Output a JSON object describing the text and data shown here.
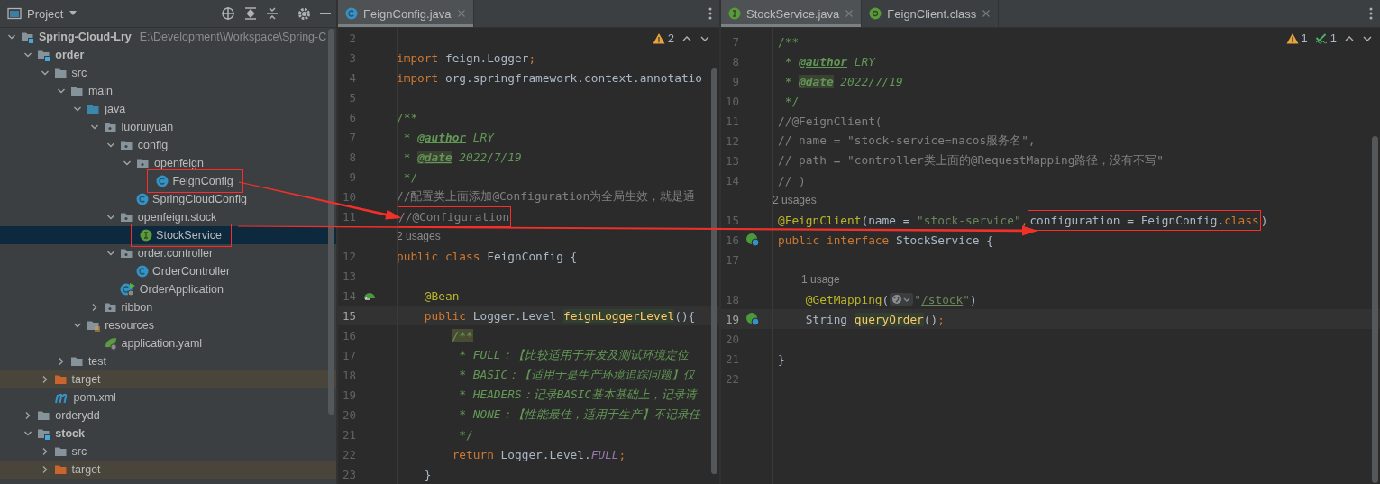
{
  "project_panel": {
    "title": "Project",
    "tree": [
      {
        "label": "Spring-Cloud-Lry",
        "kind": "module",
        "path": "E:\\Development\\Workspace\\Spring-C",
        "expanded": true,
        "selected": false,
        "boxed": false,
        "children": [
          {
            "label": "order",
            "kind": "module",
            "expanded": true,
            "selected": false,
            "boxed": false,
            "children": [
              {
                "label": "src",
                "kind": "folder",
                "expanded": true,
                "selected": false,
                "boxed": false,
                "children": [
                  {
                    "label": "main",
                    "kind": "folder",
                    "expanded": true,
                    "selected": false,
                    "boxed": false,
                    "children": [
                      {
                        "label": "java",
                        "kind": "source",
                        "expanded": true,
                        "selected": false,
                        "boxed": false,
                        "children": [
                          {
                            "label": "luoruiyuan",
                            "kind": "package",
                            "expanded": true,
                            "selected": false,
                            "boxed": false,
                            "children": [
                              {
                                "label": "config",
                                "kind": "package",
                                "expanded": true,
                                "selected": false,
                                "boxed": false,
                                "children": [
                                  {
                                    "label": "openfeign",
                                    "kind": "package",
                                    "expanded": true,
                                    "selected": false,
                                    "boxed": false,
                                    "children": [
                                      {
                                        "label": "FeignConfig",
                                        "kind": "class",
                                        "selected": false,
                                        "boxed": true
                                      }
                                    ]
                                  },
                                  {
                                    "label": "SpringCloudConfig",
                                    "kind": "class",
                                    "selected": false,
                                    "boxed": false
                                  }
                                ]
                              },
                              {
                                "label": "openfeign.stock",
                                "kind": "package",
                                "expanded": true,
                                "selected": false,
                                "boxed": false,
                                "children": [
                                  {
                                    "label": "StockService",
                                    "kind": "interface",
                                    "selected": true,
                                    "boxed": true
                                  }
                                ]
                              },
                              {
                                "label": "order.controller",
                                "kind": "package",
                                "expanded": true,
                                "selected": false,
                                "boxed": false,
                                "children": [
                                  {
                                    "label": "OrderController",
                                    "kind": "class",
                                    "selected": false,
                                    "boxed": false
                                  }
                                ]
                              },
                              {
                                "label": "OrderApplication",
                                "kind": "app",
                                "selected": false,
                                "boxed": false
                              }
                            ]
                          },
                          {
                            "label": "ribbon",
                            "kind": "package",
                            "expanded": false,
                            "selected": false,
                            "boxed": false
                          }
                        ]
                      },
                      {
                        "label": "resources",
                        "kind": "resources",
                        "expanded": true,
                        "selected": false,
                        "boxed": false,
                        "children": [
                          {
                            "label": "application.yaml",
                            "kind": "yaml",
                            "selected": false,
                            "boxed": false
                          }
                        ]
                      }
                    ]
                  },
                  {
                    "label": "test",
                    "kind": "folder",
                    "expanded": false,
                    "selected": false,
                    "boxed": false
                  }
                ]
              },
              {
                "label": "target",
                "kind": "excluded",
                "expanded": false,
                "selected": false,
                "boxed": false
              },
              {
                "label": "pom.xml",
                "kind": "maven",
                "selected": false,
                "boxed": false
              }
            ]
          },
          {
            "label": "orderydd",
            "kind": "folder",
            "expanded": false,
            "selected": false,
            "boxed": false
          },
          {
            "label": "stock",
            "kind": "module",
            "expanded": true,
            "selected": false,
            "boxed": false,
            "children": [
              {
                "label": "src",
                "kind": "folder",
                "expanded": false,
                "selected": false,
                "boxed": false
              },
              {
                "label": "target",
                "kind": "excluded",
                "expanded": false,
                "selected": false,
                "boxed": false
              }
            ]
          }
        ]
      }
    ]
  },
  "editors": [
    {
      "tabs": [
        {
          "label": "FeignConfig.java",
          "kind": "class",
          "selected": true
        }
      ],
      "inspections": [
        {
          "kind": "warning",
          "count": "2"
        }
      ],
      "lines": [
        {
          "kind": "code",
          "number": "2",
          "current": false
        },
        {
          "kind": "code",
          "number": "3",
          "current": false,
          "tokens": [
            {
              "kind": "keyword",
              "text": "import"
            },
            {
              "kind": "plain",
              "text": " feign.Logger"
            },
            {
              "kind": "keyword",
              "text": ";"
            }
          ]
        },
        {
          "kind": "code",
          "number": "4",
          "current": false,
          "tokens": [
            {
              "kind": "keyword",
              "text": "import"
            },
            {
              "kind": "plain",
              "text": " org.springframework.context.annotatio"
            }
          ]
        },
        {
          "kind": "code",
          "number": "5",
          "current": false
        },
        {
          "kind": "code",
          "number": "6",
          "current": false,
          "tokens": [
            {
              "kind": "doc",
              "text": "/**"
            }
          ]
        },
        {
          "kind": "code",
          "number": "7",
          "current": false,
          "tokens": [
            {
              "kind": "doc",
              "text": " * "
            },
            {
              "kind": "doc-tag",
              "text": "@author"
            },
            {
              "kind": "doc-italic",
              "text": " LRY"
            }
          ]
        },
        {
          "kind": "code",
          "number": "8",
          "current": false,
          "tokens": [
            {
              "kind": "doc",
              "text": " * "
            },
            {
              "kind": "doc-tag-marked",
              "text": "@date"
            },
            {
              "kind": "doc-italic",
              "text": " 2022/7/19"
            }
          ]
        },
        {
          "kind": "code",
          "number": "9",
          "current": false,
          "tokens": [
            {
              "kind": "doc",
              "text": " */"
            }
          ]
        },
        {
          "kind": "code",
          "number": "10",
          "current": false,
          "tokens": [
            {
              "kind": "comment",
              "text": "//配置类上面添加@Configuration为全局生效，就是通"
            }
          ]
        },
        {
          "kind": "code",
          "number": "11",
          "current": false,
          "tokens": [
            {
              "kind": "comment",
              "text": "//@Configuration",
              "boxed": true
            }
          ]
        },
        {
          "kind": "hint",
          "text": "2 usages",
          "nested": false
        },
        {
          "kind": "code",
          "number": "12",
          "current": false,
          "tokens": [
            {
              "kind": "keyword",
              "text": "public class "
            },
            {
              "kind": "plain",
              "text": "FeignConfig {"
            }
          ]
        },
        {
          "kind": "code",
          "number": "13",
          "current": false
        },
        {
          "kind": "code",
          "number": "14",
          "current": false,
          "gutter_icon": {
            "kind": "bean"
          },
          "tokens": [
            {
              "kind": "annotation",
              "text": "    @Bean"
            }
          ]
        },
        {
          "kind": "code",
          "number": "15",
          "current": true,
          "tokens": [
            {
              "kind": "keyword",
              "text": "    public "
            },
            {
              "kind": "plain",
              "text": "Logger.Level "
            },
            {
              "kind": "method-marked",
              "text": "feignLoggerLevel"
            },
            {
              "kind": "plain",
              "text": "(){"
            }
          ]
        },
        {
          "kind": "code",
          "number": "16",
          "current": false,
          "tokens": [
            {
              "kind": "doc-marked",
              "text": "        /**"
            }
          ]
        },
        {
          "kind": "code",
          "number": "17",
          "current": false,
          "tokens": [
            {
              "kind": "doc-italic",
              "text": "         * FULL：【比较适用于开发及测试环境定位"
            }
          ]
        },
        {
          "kind": "code",
          "number": "18",
          "current": false,
          "tokens": [
            {
              "kind": "doc-italic",
              "text": "         * BASIC：【适用于是生产环境追踪问题】仅"
            }
          ]
        },
        {
          "kind": "code",
          "number": "19",
          "current": false,
          "tokens": [
            {
              "kind": "doc-italic",
              "text": "         * HEADERS：记录BASIC基本基础上，记录请"
            }
          ]
        },
        {
          "kind": "code",
          "number": "20",
          "current": false,
          "tokens": [
            {
              "kind": "doc-italic",
              "text": "         * NONE：【性能最佳，适用于生产】不记录任"
            }
          ]
        },
        {
          "kind": "code",
          "number": "21",
          "current": false,
          "tokens": [
            {
              "kind": "doc",
              "text": "         */"
            }
          ]
        },
        {
          "kind": "code",
          "number": "22",
          "current": false,
          "tokens": [
            {
              "kind": "keyword",
              "text": "        return "
            },
            {
              "kind": "plain",
              "text": "Logger.Level."
            },
            {
              "kind": "constant",
              "text": "FULL"
            },
            {
              "kind": "keyword",
              "text": ";"
            }
          ]
        },
        {
          "kind": "code",
          "number": "23",
          "current": false,
          "tokens": [
            {
              "kind": "plain",
              "text": "    }"
            }
          ]
        }
      ]
    },
    {
      "tabs": [
        {
          "label": "StockService.java",
          "kind": "interface",
          "selected": true
        },
        {
          "label": "FeignClient.class",
          "kind": "annotation",
          "selected": false
        }
      ],
      "inspections": [
        {
          "kind": "warning",
          "count": "1"
        },
        {
          "kind": "typo",
          "count": "1"
        }
      ],
      "lines": [
        {
          "kind": "code",
          "number": "7",
          "current": false,
          "tokens": [
            {
              "kind": "doc",
              "text": "/**"
            }
          ]
        },
        {
          "kind": "code",
          "number": "8",
          "current": false,
          "tokens": [
            {
              "kind": "doc",
              "text": " * "
            },
            {
              "kind": "doc-tag",
              "text": "@author"
            },
            {
              "kind": "doc-italic",
              "text": " LRY"
            }
          ]
        },
        {
          "kind": "code",
          "number": "9",
          "current": false,
          "tokens": [
            {
              "kind": "doc",
              "text": " * "
            },
            {
              "kind": "doc-tag-marked",
              "text": "@date"
            },
            {
              "kind": "doc-italic",
              "text": " 2022/7/19"
            }
          ]
        },
        {
          "kind": "code",
          "number": "10",
          "current": false,
          "tokens": [
            {
              "kind": "doc",
              "text": " */"
            }
          ]
        },
        {
          "kind": "code",
          "number": "11",
          "current": false,
          "tokens": [
            {
              "kind": "comment",
              "text": "//@FeignClient("
            }
          ]
        },
        {
          "kind": "code",
          "number": "12",
          "current": false,
          "tokens": [
            {
              "kind": "comment",
              "text": "// name = \"stock-service=nacos服务名\","
            }
          ]
        },
        {
          "kind": "code",
          "number": "13",
          "current": false,
          "tokens": [
            {
              "kind": "comment",
              "text": "// path = \"controller类上面的@RequestMapping路径，没有不写\""
            }
          ]
        },
        {
          "kind": "code",
          "number": "14",
          "current": false,
          "tokens": [
            {
              "kind": "comment",
              "text": "// )"
            }
          ]
        },
        {
          "kind": "hint",
          "text": "2 usages",
          "nested": false
        },
        {
          "kind": "code",
          "number": "15",
          "current": false,
          "tokens": [
            {
              "kind": "annotation",
              "text": "@FeignClient"
            },
            {
              "kind": "plain",
              "text": "(name = "
            },
            {
              "kind": "string",
              "text": "\"stock-service\""
            },
            {
              "kind": "keyword",
              "text": ","
            },
            {
              "kind": "plain",
              "text": "configuration = FeignConfig.",
              "boxed": true
            },
            {
              "kind": "keyword",
              "text": "class",
              "boxed": true
            },
            {
              "kind": "plain",
              "text": ")"
            }
          ]
        },
        {
          "kind": "code",
          "number": "16",
          "current": false,
          "gutter_icon": {
            "kind": "spring"
          },
          "tokens": [
            {
              "kind": "keyword",
              "text": "public interface "
            },
            {
              "kind": "plain",
              "text": "StockService {"
            }
          ]
        },
        {
          "kind": "code",
          "number": "17",
          "current": false
        },
        {
          "kind": "hint",
          "text": "1 usage",
          "nested": true
        },
        {
          "kind": "code",
          "number": "18",
          "current": false,
          "tokens": [
            {
              "kind": "annotation",
              "text": "    @GetMapping"
            },
            {
              "kind": "plain",
              "text": "("
            },
            {
              "kind": "inlay"
            },
            {
              "kind": "string",
              "text": "\""
            },
            {
              "kind": "string-link",
              "text": "/stock"
            },
            {
              "kind": "string",
              "text": "\""
            },
            {
              "kind": "plain",
              "text": ")"
            }
          ]
        },
        {
          "kind": "code",
          "number": "19",
          "current": true,
          "gutter_icon": {
            "kind": "spring"
          },
          "tokens": [
            {
              "kind": "plain",
              "text": "    String "
            },
            {
              "kind": "method-marked",
              "text": "queryOrder"
            },
            {
              "kind": "plain",
              "text": "()"
            },
            {
              "kind": "keyword",
              "text": ";"
            }
          ]
        },
        {
          "kind": "code",
          "number": "20",
          "current": false
        },
        {
          "kind": "code",
          "number": "21",
          "current": false,
          "tokens": [
            {
              "kind": "plain",
              "text": "}"
            }
          ]
        },
        {
          "kind": "code",
          "number": "22",
          "current": false
        }
      ]
    }
  ]
}
